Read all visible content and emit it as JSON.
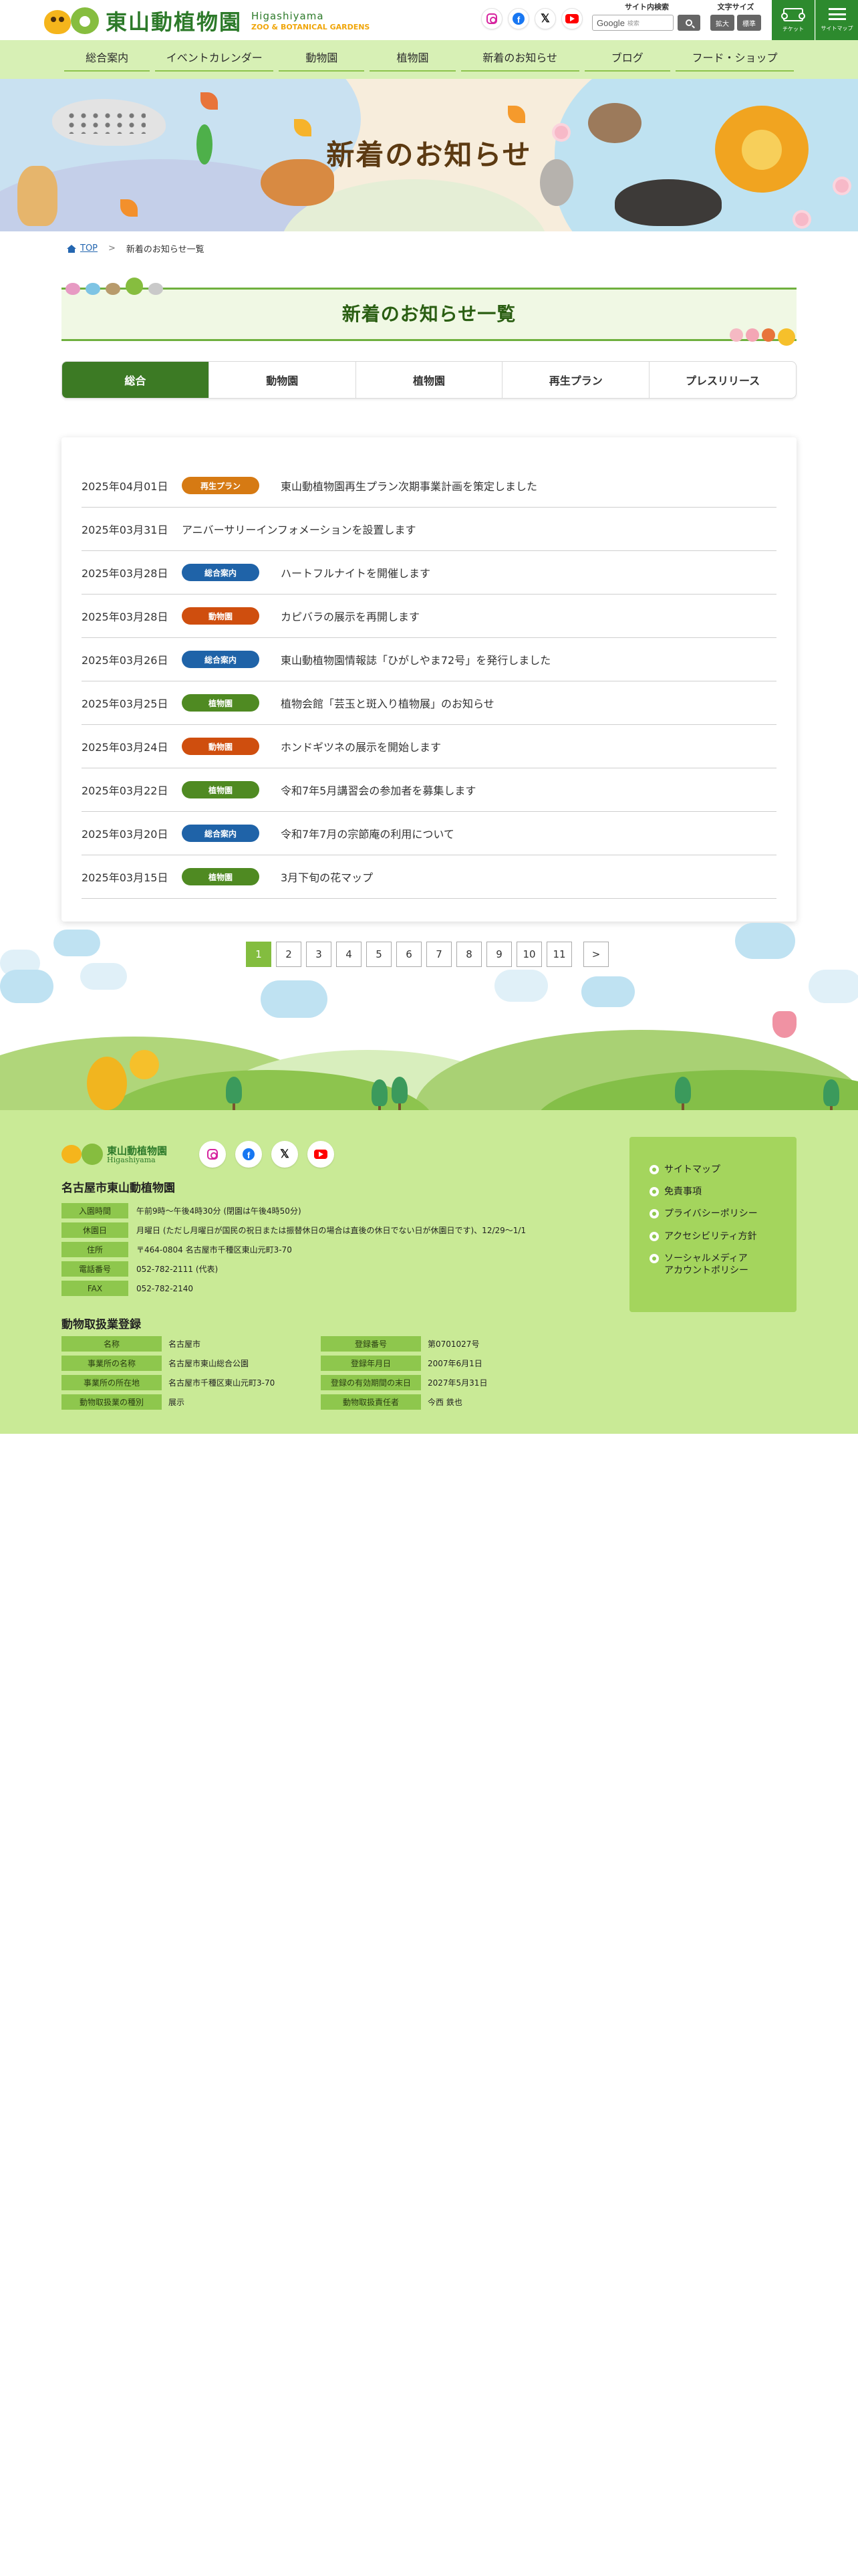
{
  "header": {
    "logo_text": "東山動植物園",
    "logo_en": "Higashiyama",
    "logo_sub": "ZOO & BOTANICAL GARDENS",
    "sns": [
      "instagram-icon",
      "facebook-icon",
      "x-icon",
      "youtube-icon"
    ],
    "search_label": "サイト内検索",
    "search_placeholder": "検索",
    "search_brand": "Google",
    "fontsize_label": "文字サイズ",
    "fontsize_large": "拡大",
    "fontsize_normal": "標準",
    "ticket_label": "チケット",
    "menu_label": "サイトマップ"
  },
  "nav": [
    "総合案内",
    "イベントカレンダー",
    "動物園",
    "植物園",
    "新着のお知らせ",
    "ブログ",
    "フード・ショップ"
  ],
  "hero": {
    "title": "新着のお知らせ"
  },
  "breadcrumb": {
    "home": "TOP",
    "separator": ">",
    "current": "新着のお知らせ一覧"
  },
  "section": {
    "title": "新着のお知らせ一覧"
  },
  "tabs": [
    {
      "label": "総合",
      "active": true
    },
    {
      "label": "動物園",
      "active": false
    },
    {
      "label": "植物園",
      "active": false
    },
    {
      "label": "再生プラン",
      "active": false
    },
    {
      "label": "プレスリリース",
      "active": false
    }
  ],
  "category_colors": {
    "再生プラン": "#d67a13",
    "総合案内": "#1f63a8",
    "動物園": "#cf4e0e",
    "植物園": "#4f8a22"
  },
  "news": [
    {
      "date": "2025年04月01日",
      "category": "再生プラン",
      "title": "東山動植物園再生プラン次期事業計画を策定しました"
    },
    {
      "date": "2025年03月31日",
      "category": "",
      "title": "アニバーサリーインフォメーションを設置します"
    },
    {
      "date": "2025年03月28日",
      "category": "総合案内",
      "title": "ハートフルナイトを開催します"
    },
    {
      "date": "2025年03月28日",
      "category": "動物園",
      "title": "カピバラの展示を再開します"
    },
    {
      "date": "2025年03月26日",
      "category": "総合案内",
      "title": "東山動植物園情報誌「ひがしやま72号」を発行しました"
    },
    {
      "date": "2025年03月25日",
      "category": "植物園",
      "title": "植物会館「芸玉と斑入り植物展」のお知らせ"
    },
    {
      "date": "2025年03月24日",
      "category": "動物園",
      "title": "ホンドギツネの展示を開始します"
    },
    {
      "date": "2025年03月22日",
      "category": "植物園",
      "title": "令和7年5月講習会の参加者を募集します"
    },
    {
      "date": "2025年03月20日",
      "category": "総合案内",
      "title": "令和7年7月の宗節庵の利用について"
    },
    {
      "date": "2025年03月15日",
      "category": "植物園",
      "title": "3月下旬の花マップ"
    }
  ],
  "pagination": {
    "pages": [
      "1",
      "2",
      "3",
      "4",
      "5",
      "6",
      "7",
      "8",
      "9",
      "10",
      "11"
    ],
    "current": "1",
    "next": ">"
  },
  "footer": {
    "name": "名古屋市東山動植物園",
    "logo_text": "東山動植物園",
    "logo_en": "Higashiyama",
    "info": [
      {
        "key": "入園時間",
        "value": "午前9時～午後4時30分 (閉園は午後4時50分)"
      },
      {
        "key": "休園日",
        "value": "月曜日 (ただし月曜日が国民の祝日または振替休日の場合は直後の休日でない日が休園日です)、12/29～1/1"
      },
      {
        "key": "住所",
        "value": "〒464-0804 名古屋市千種区東山元町3-70"
      },
      {
        "key": "電話番号",
        "value": "052-782-2111 (代表)"
      },
      {
        "key": "FAX",
        "value": "052-782-2140"
      }
    ],
    "links": [
      "サイトマップ",
      "免責事項",
      "プライバシーポリシー",
      "アクセシビリティ方針",
      "ソーシャルメディア\nアカウントポリシー"
    ],
    "registration_title": "動物取扱業登録",
    "registration": [
      {
        "k1": "名称",
        "v1": "名古屋市",
        "k2": "登録番号",
        "v2": "第0701027号"
      },
      {
        "k1": "事業所の名称",
        "v1": "名古屋市東山総合公園",
        "k2": "登録年月日",
        "v2": "2007年6月1日"
      },
      {
        "k1": "事業所の所在地",
        "v1": "名古屋市千種区東山元町3-70",
        "k2": "登録の有効期間の末日",
        "v2": "2027年5月31日"
      },
      {
        "k1": "動物取扱業の種別",
        "v1": "展示",
        "k2": "動物取扱責任者",
        "v2": "今西 鉄也"
      }
    ]
  }
}
